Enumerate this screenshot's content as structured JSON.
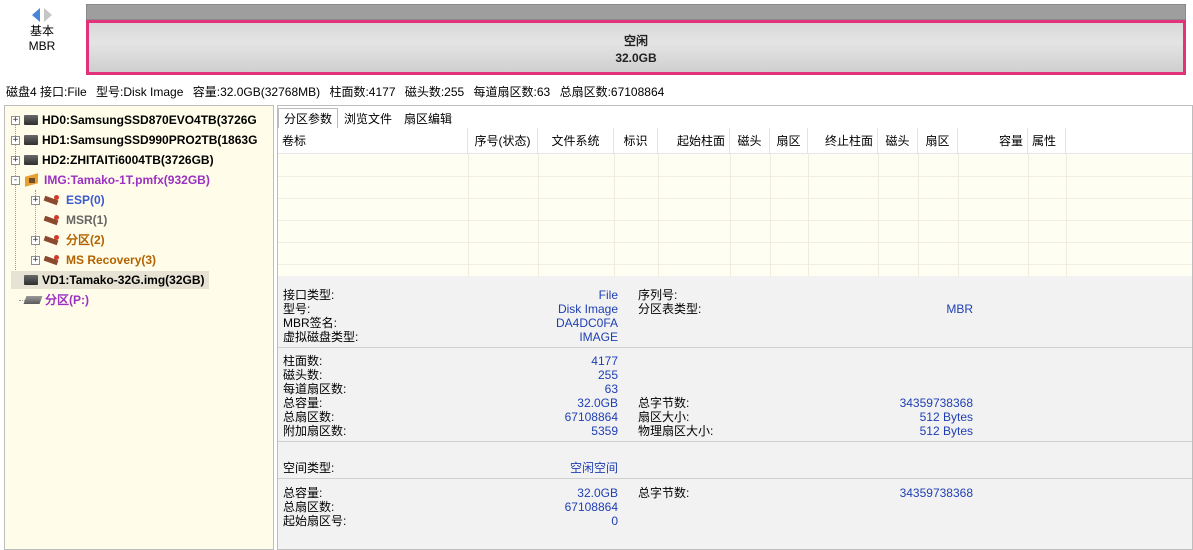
{
  "nav": {
    "line1": "基本",
    "line2": "MBR"
  },
  "partition": {
    "label": "空闲",
    "size": "32.0GB"
  },
  "info_line": [
    "磁盘4 接口:File",
    "型号:Disk Image",
    "容量:32.0GB(32768MB)",
    "柱面数:4177",
    "磁头数:255",
    "每道扇区数:63",
    "总扇区数:67108864"
  ],
  "tree": {
    "items": [
      {
        "text": "HD0:SamsungSSD870EVO4TB(3726G"
      },
      {
        "text": "HD1:SamsungSSD990PRO2TB(1863G"
      },
      {
        "text": "HD2:ZHITAITi6004TB(3726GB)"
      },
      {
        "text": "IMG:Tamako-1T.pmfx(932GB)"
      },
      {
        "text": "ESP(0)"
      },
      {
        "text": "MSR(1)"
      },
      {
        "text": "分区(2)"
      },
      {
        "text": "MS Recovery(3)"
      },
      {
        "text": "VD1:Tamako-32G.img(32GB)"
      },
      {
        "text": "分区(P:)"
      }
    ]
  },
  "tabs": [
    "分区参数",
    "浏览文件",
    "扇区编辑"
  ],
  "columns": [
    "卷标",
    "序号(状态)",
    "文件系统",
    "标识",
    "起始柱面",
    "磁头",
    "扇区",
    "终止柱面",
    "磁头",
    "扇区",
    "容量",
    "属性"
  ],
  "details": {
    "iface_type_k": "接口类型:",
    "iface_type_v": "File",
    "model_k": "型号:",
    "model_v": "Disk Image",
    "mbr_sig_k": "MBR签名:",
    "mbr_sig_v": "DA4DC0FA",
    "vdisk_type_k": "虚拟磁盘类型:",
    "vdisk_type_v": "IMAGE",
    "serial_k": "序列号:",
    "serial_v": "",
    "ptable_type_k": "分区表类型:",
    "ptable_type_v": "MBR",
    "cylinders_k": "柱面数:",
    "cylinders_v": "4177",
    "heads_k": "磁头数:",
    "heads_v": "255",
    "spt_k": "每道扇区数:",
    "spt_v": "63",
    "capacity_k": "总容量:",
    "capacity_v": "32.0GB",
    "total_sectors_k": "总扇区数:",
    "total_sectors_v": "67108864",
    "extra_sectors_k": "附加扇区数:",
    "extra_sectors_v": "5359",
    "total_bytes_k": "总字节数:",
    "total_bytes_v": "34359738368",
    "sector_size_k": "扇区大小:",
    "sector_size_v": "512 Bytes",
    "phys_sector_k": "物理扇区大小:",
    "phys_sector_v": "512 Bytes",
    "space_type_k": "空间类型:",
    "space_type_v": "空闲空间",
    "free_capacity_k": "总容量:",
    "free_capacity_v": "32.0GB",
    "free_total_sectors_k": "总扇区数:",
    "free_total_sectors_v": "67108864",
    "start_sector_k": "起始扇区号:",
    "start_sector_v": "0",
    "free_total_bytes_k": "总字节数:",
    "free_total_bytes_v": "34359738368"
  }
}
